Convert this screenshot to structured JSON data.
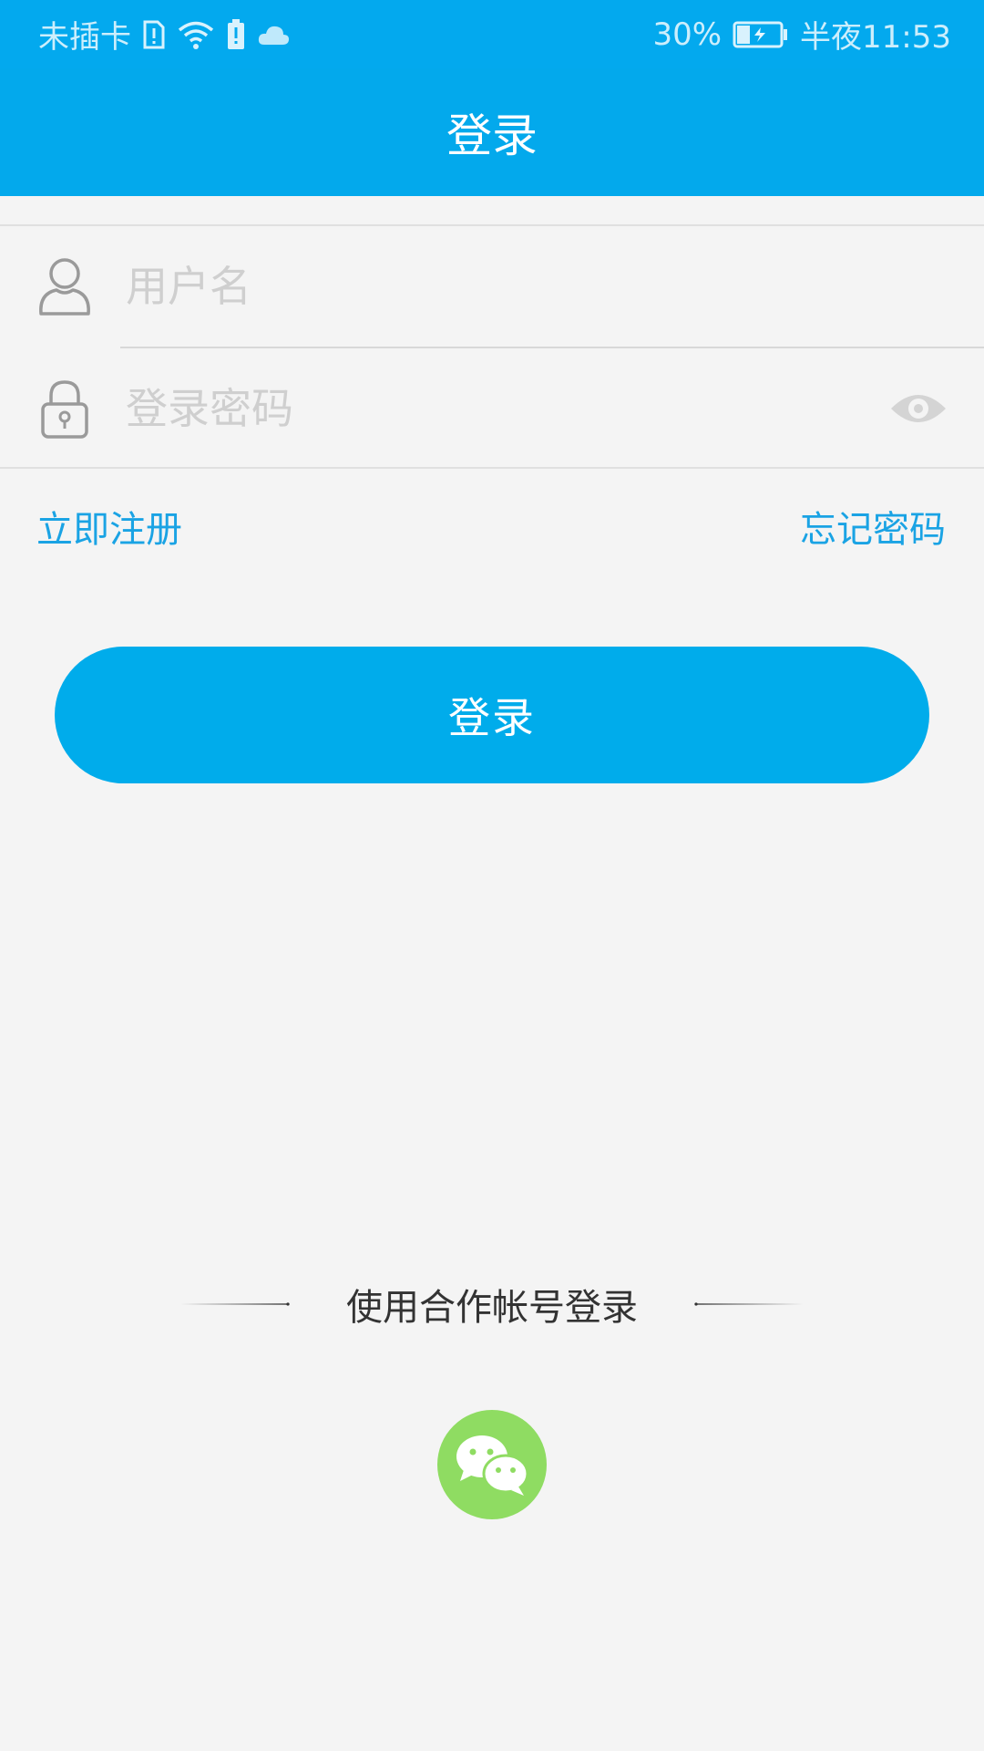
{
  "status_bar": {
    "carrier": "未插卡",
    "battery_percent": "30%",
    "time": "半夜11:53",
    "icons": [
      "sim-alert-icon",
      "wifi-icon",
      "battery-saver-icon",
      "cloud-icon",
      "battery-charging-icon"
    ]
  },
  "header": {
    "title": "登录"
  },
  "form": {
    "username": {
      "placeholder": "用户名",
      "value": "",
      "icon": "user-icon"
    },
    "password": {
      "placeholder": "登录密码",
      "value": "",
      "icon": "lock-icon",
      "toggle_icon": "eye-icon"
    }
  },
  "links": {
    "register": "立即注册",
    "forgot": "忘记密码"
  },
  "login_button": {
    "label": "登录"
  },
  "partner": {
    "label": "使用合作帐号登录",
    "providers": [
      "wechat-icon"
    ]
  },
  "colors": {
    "primary": "#03a9ec",
    "link": "#1aa3e4",
    "wechat": "#8fdc62",
    "background": "#f4f4f4"
  }
}
